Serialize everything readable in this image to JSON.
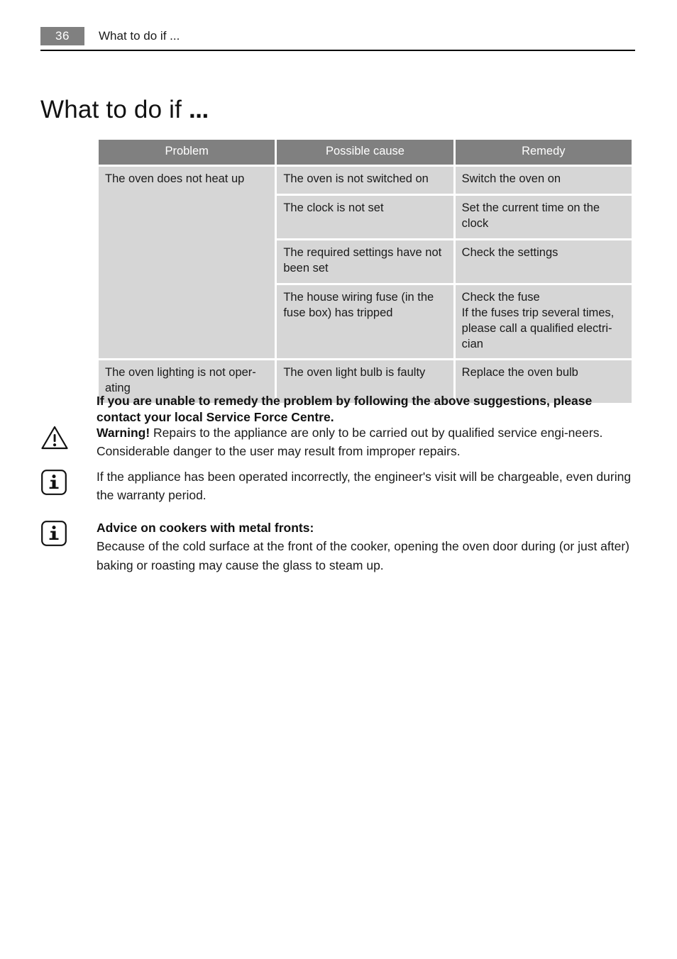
{
  "header": {
    "page_number": "36",
    "title": "What to do if ..."
  },
  "chapter": {
    "title": "What to do if",
    "ellipsis": "..."
  },
  "table": {
    "columns": [
      "Problem",
      "Possible cause",
      "Remedy"
    ],
    "rows": [
      {
        "problem": "The oven does not heat up",
        "cause": "The oven is not switched on",
        "remedy": "Switch the oven on"
      },
      {
        "problem": "",
        "cause": "The clock is not set",
        "remedy": "Set the current time on the clock"
      },
      {
        "problem": "",
        "cause": "The required settings have not been set",
        "remedy": "Check the settings"
      },
      {
        "problem": "",
        "cause": "The house wiring fuse (in the fuse box) has tripped",
        "remedy": "Check the fuse\nIf the fuses trip several times, please call a qualified electri-cian"
      },
      {
        "problem": "The oven lighting is not oper-ating",
        "cause": "The oven light bulb is faulty",
        "remedy": "Replace the oven bulb"
      }
    ],
    "remedy_fuse_line1": "Check the fuse",
    "remedy_fuse_line2": "If the fuses trip several times, please call a qualified electri-cian"
  },
  "body": {
    "lead_bold": "If you are unable to remedy the problem by following the above suggestions, please contact your local Service Force Centre.",
    "warning_label": "Warning!",
    "warning_text": " Repairs to the appliance are only to be carried out by qualified service engi-neers. Considerable danger to the user may result from improper repairs.",
    "info_1": "If the appliance has been operated incorrectly, the engineer's visit will be chargeable, even during the warranty period.",
    "info_2_heading": "Advice on cookers with metal fronts:",
    "info_2_text": "Because of the cold surface at the front of the cooker, opening the oven door during (or just after) baking or roasting may cause the glass to steam up."
  },
  "colors": {
    "header_gray": "#808080",
    "cell_gray": "#d6d6d6",
    "text": "#1a1a1a",
    "rule": "#000000"
  }
}
